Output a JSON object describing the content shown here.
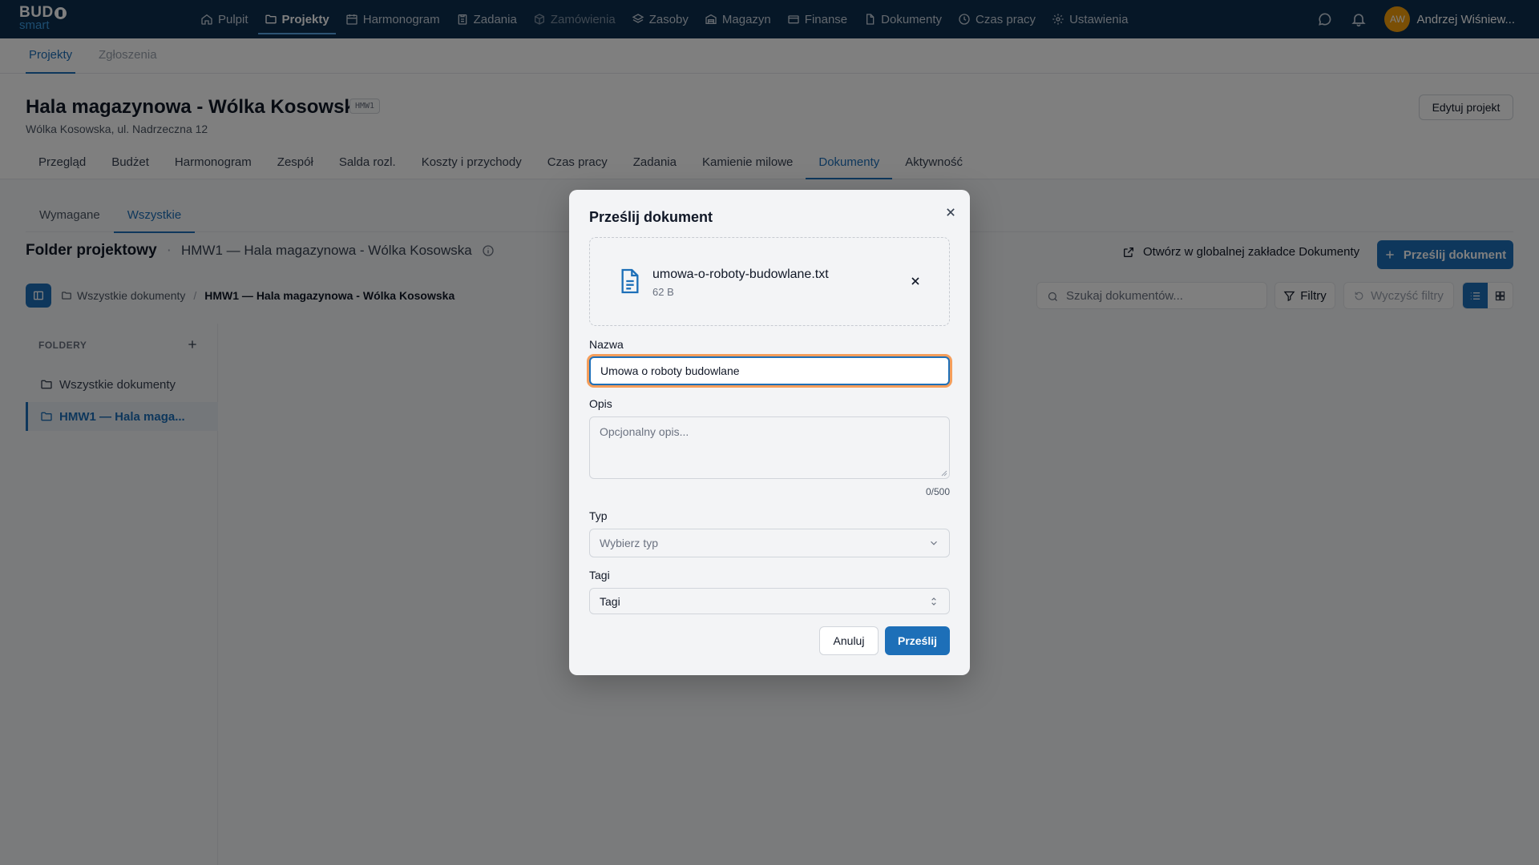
{
  "app": {
    "logo_top": "BUD",
    "logo_bottom": "smart"
  },
  "nav": {
    "items": [
      {
        "label": "Pulpit",
        "icon": "home-icon"
      },
      {
        "label": "Projekty",
        "icon": "folder-icon"
      },
      {
        "label": "Harmonogram",
        "icon": "calendar-icon"
      },
      {
        "label": "Zadania",
        "icon": "clipboard-icon"
      },
      {
        "label": "Zamówienia",
        "icon": "package-icon"
      },
      {
        "label": "Zasoby",
        "icon": "layers-icon"
      },
      {
        "label": "Magazyn",
        "icon": "warehouse-icon"
      },
      {
        "label": "Finanse",
        "icon": "wallet-icon"
      },
      {
        "label": "Dokumenty",
        "icon": "document-icon"
      },
      {
        "label": "Czas pracy",
        "icon": "clock-icon"
      },
      {
        "label": "Ustawienia",
        "icon": "gear-icon"
      }
    ],
    "active": "Projekty",
    "user": {
      "initials": "AW",
      "name": "Andrzej Wiśniew..."
    }
  },
  "subnav": {
    "tabs": [
      "Projekty",
      "Zgłoszenia"
    ]
  },
  "project": {
    "title": "Hala magazynowa - Wólka Kosowska",
    "code": "HMW1",
    "address": "Wólka Kosowska, ul. Nadrzeczna 12",
    "edit_label": "Edytuj projekt",
    "tabs": [
      "Przegląd",
      "Budżet",
      "Harmonogram",
      "Zespół",
      "Salda rozl.",
      "Koszty i przychody",
      "Czas pracy",
      "Zadania",
      "Kamienie milowe",
      "Dokumenty",
      "Aktywność"
    ]
  },
  "documents": {
    "tabs": [
      "Wymagane",
      "Wszystkie"
    ],
    "folder_title": "Folder projektowy",
    "folder_sub": "HMW1 — Hala magazynowa - Wólka Kosowska",
    "open_global": "Otwórz w globalnej zakładce Dokumenty",
    "upload_label": "Prześlij dokument",
    "breadcrumb": {
      "root": "Wszystkie dokumenty",
      "current": "HMW1 — Hala magazynowa - Wólka Kosowska"
    },
    "search_placeholder": "Szukaj dokumentów...",
    "filters_label": "Filtry",
    "clear_label": "Wyczyść filtry",
    "folders_header": "FOLDERY",
    "folders": [
      "Wszystkie dokumenty",
      "HMW1 — Hala maga..."
    ]
  },
  "modal": {
    "title": "Prześlij dokument",
    "file": {
      "name": "umowa-o-roboty-budowlane.txt",
      "size": "62 B"
    },
    "name_label": "Nazwa",
    "name_value": "Umowa o roboty budowlane",
    "desc_label": "Opis",
    "desc_placeholder": "Opcjonalny opis...",
    "counter": "0/500",
    "type_label": "Typ",
    "type_placeholder": "Wybierz typ",
    "tags_label": "Tagi",
    "tags_value": "Tagi",
    "cancel_label": "Anuluj",
    "submit_label": "Prześlij"
  },
  "colors": {
    "nav_bg": "#0d2f4f",
    "accent": "#1d6fb8",
    "focus_ring": "#f59e5b"
  }
}
